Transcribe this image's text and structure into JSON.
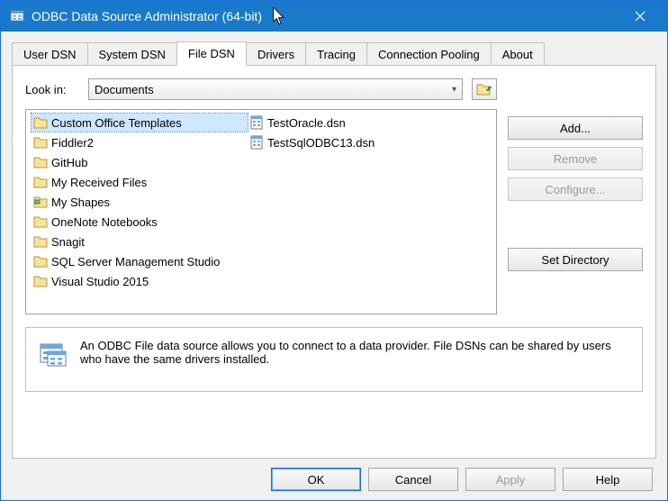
{
  "titlebar": {
    "title": "ODBC Data Source Administrator (64-bit)"
  },
  "tabs": [
    {
      "label": "User DSN"
    },
    {
      "label": "System DSN"
    },
    {
      "label": "File DSN"
    },
    {
      "label": "Drivers"
    },
    {
      "label": "Tracing"
    },
    {
      "label": "Connection Pooling"
    },
    {
      "label": "About"
    }
  ],
  "lookin": {
    "label": "Look in:",
    "value": "Documents"
  },
  "folders": [
    "Custom Office Templates",
    "Fiddler2",
    "GitHub",
    "My Received Files",
    "My Shapes",
    "OneNote Notebooks",
    "Snagit",
    "SQL Server Management Studio",
    "Visual Studio 2015"
  ],
  "dsn_files": [
    "TestOracle.dsn",
    "TestSqlODBC13.dsn"
  ],
  "sidebuttons": {
    "add": "Add...",
    "remove": "Remove",
    "configure": "Configure...",
    "setdir": "Set Directory"
  },
  "info": {
    "text": "An ODBC File data source allows you to connect to a data provider.  File DSNs can be shared by users who have the same drivers installed."
  },
  "buttons": {
    "ok": "OK",
    "cancel": "Cancel",
    "apply": "Apply",
    "help": "Help"
  }
}
